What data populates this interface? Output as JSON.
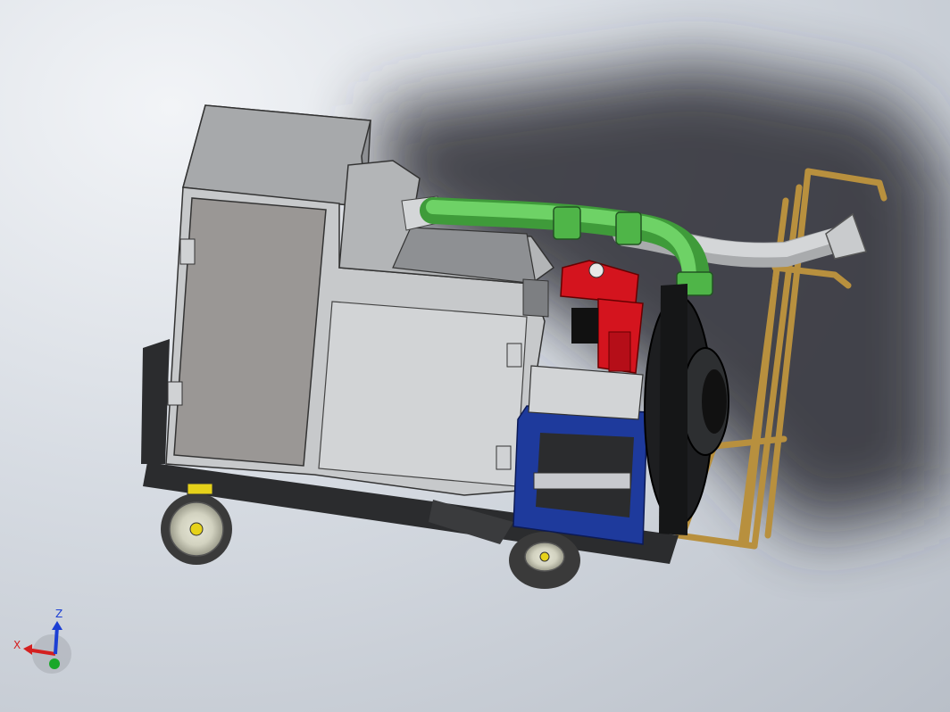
{
  "viewport": {
    "background": "#d6dbe2",
    "shadow": "#2a2c30"
  },
  "model": {
    "colors": {
      "housing": "#c7c9cb",
      "housing_dark": "#8e9093",
      "door_panel": "#9a9795",
      "pipe_green": "#5cbf55",
      "pipe_grey": "#c9cbcd",
      "engine_red": "#d4141e",
      "frame_blue": "#1e3a9c",
      "frame_tan": "#b8903e",
      "chassis": "#2b2c2e",
      "tire": "#3a3a3a",
      "hub": "#d9d9c0",
      "hub_yellow": "#e6d21a"
    }
  },
  "triad": {
    "x_label": "X",
    "z_label": "Z",
    "x_color": "#d42020",
    "z_color": "#1c3fd4",
    "y_color": "#1aa82a"
  }
}
